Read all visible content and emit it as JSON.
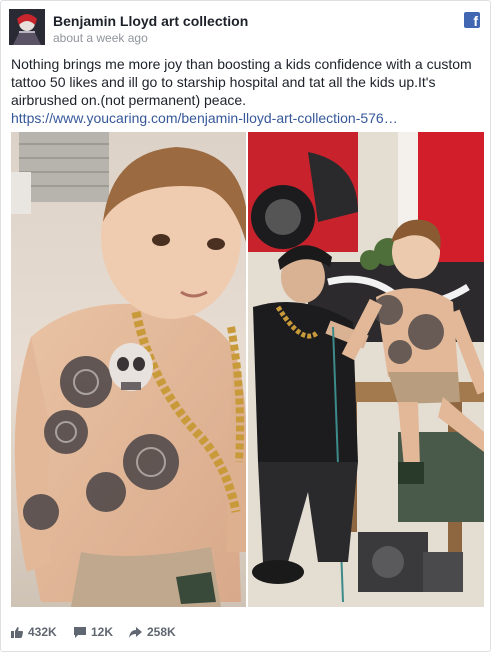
{
  "post": {
    "page_name": "Benjamin Lloyd art collection",
    "timestamp": "about a week ago",
    "caption_text": "Nothing brings me more joy than boosting a kids confidence with a custom tattoo 50 likes and ill go to starship hospital and tat all the kids up.It's airbrushed on.(not permanent) peace.",
    "caption_link": "https://www.youcaring.com/benjamin-lloyd-art-collection-576…",
    "platform_logo": "f"
  },
  "stats": {
    "likes": "432K",
    "comments": "12K",
    "shares": "258K"
  },
  "icons": {
    "platform": "facebook-icon",
    "likes": "thumbs-up-icon",
    "comments": "comment-icon",
    "shares": "share-arrow-icon"
  },
  "colors": {
    "link": "#365899",
    "brand": "#4267b2",
    "meta": "#90949c"
  }
}
